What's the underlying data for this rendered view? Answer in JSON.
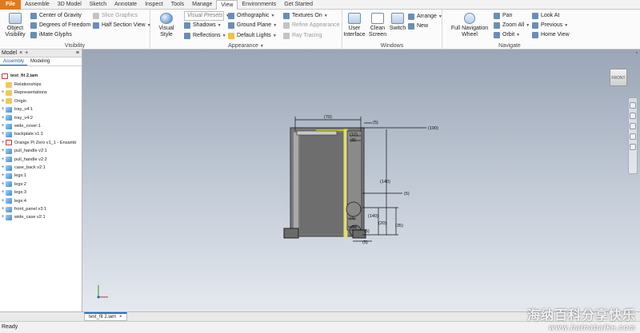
{
  "menu": {
    "file": "File",
    "tabs": [
      "Assemble",
      "3D Model",
      "Sketch",
      "Annotate",
      "Inspect",
      "Tools",
      "Manage",
      "View",
      "Environments",
      "Get Started"
    ],
    "active_index": 7
  },
  "ribbon": {
    "visibility": {
      "title": "Visibility",
      "object_visibility": "Object Visibility",
      "center_of_gravity": "Center of Gravity",
      "degrees_of_freedom": "Degrees of Freedom",
      "imate_glyphs": "iMate Glyphs",
      "slice_graphics": "Slice Graphics",
      "half_section_view": "Half Section View"
    },
    "appearance": {
      "title": "Appearance",
      "visual_style": "Visual Style",
      "visual_presets": "Visual Presets",
      "orthographic": "Orthographic",
      "textures_on": "Textures On",
      "shadows": "Shadows",
      "ground_plane": "Ground Plane",
      "refine_appearance": "Refine Appearance",
      "reflections": "Reflections",
      "default_lights": "Default Lights",
      "ray_tracing": "Ray Tracing"
    },
    "windows": {
      "title": "Windows",
      "user_interface": "User Interface",
      "clean_screen": "Clean Screen",
      "switch": "Switch",
      "arrange": "Arrange",
      "new": "New"
    },
    "navigate": {
      "title": "Navigate",
      "full_navigation_wheel": "Full Navigation Wheel",
      "pan": "Pan",
      "zoom_all": "Zoom All",
      "orbit": "Orbit",
      "look_at": "Look At",
      "previous": "Previous",
      "home_view": "Home View"
    }
  },
  "browser": {
    "header": "Model",
    "tabs": [
      "Assembly",
      "Modeling"
    ],
    "root": "test_fit 2.iam",
    "items": [
      {
        "label": "Relationships",
        "type": "folder"
      },
      {
        "label": "Representations",
        "type": "folder"
      },
      {
        "label": "Origin",
        "type": "folder"
      },
      {
        "label": "tray_v4:1",
        "type": "part"
      },
      {
        "label": "tray_v4:2",
        "type": "part"
      },
      {
        "label": "wide_cover:1",
        "type": "part"
      },
      {
        "label": "backplate v1:1",
        "type": "part"
      },
      {
        "label": "Orange Pi Zero v1_1 - Ensamb",
        "type": "asm"
      },
      {
        "label": "pull_handle v2:1",
        "type": "part"
      },
      {
        "label": "pull_handle v2:2",
        "type": "part"
      },
      {
        "label": "case_back v2:1",
        "type": "part"
      },
      {
        "label": "legs:1",
        "type": "part"
      },
      {
        "label": "legs:2",
        "type": "part"
      },
      {
        "label": "legs:3",
        "type": "part"
      },
      {
        "label": "legs:4",
        "type": "part"
      },
      {
        "label": "front_panel v3:1",
        "type": "part"
      },
      {
        "label": "wide_case v2:1",
        "type": "part"
      }
    ]
  },
  "viewport": {
    "viewcube_label": "FRONT",
    "dimensions": {
      "d70": "(70)",
      "d5a": "(5)",
      "d190": "(190)",
      "d12": "(12)",
      "d8": "(8)",
      "d140a": "(140)",
      "d5b": "(5)",
      "d140b": "(140)",
      "d20": "(20)",
      "d35": "(35)",
      "d4": "(4)",
      "d5c": "(5)",
      "d5d": "(5)",
      "d5e": "(5)"
    }
  },
  "document_tab": {
    "label": "test_fit 2.iam",
    "close": "×"
  },
  "status": {
    "text": "Ready"
  },
  "watermark": {
    "line1": "海纳百科分享快乐",
    "line2": "www.hainabaike.com"
  }
}
